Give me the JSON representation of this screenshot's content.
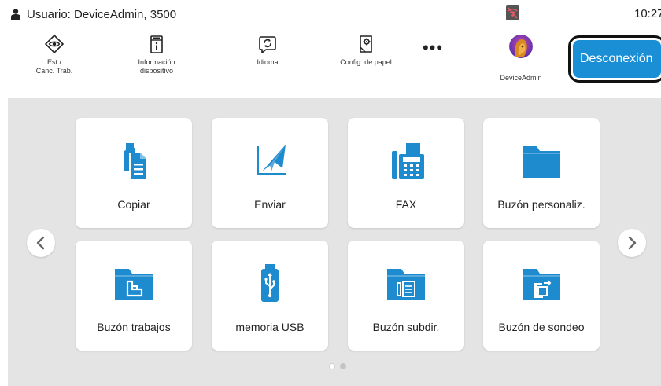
{
  "status_bar": {
    "user_text": "Usuario:  DeviceAdmin, 3500",
    "clock": "10:27",
    "user_icon": "user-icon",
    "network_icon": "wifi-off-icon"
  },
  "toolbar": {
    "items": [
      {
        "label": "Est./\nCanc. Trab.",
        "icon": "eye-diamond-icon"
      },
      {
        "label": "Información\ndispositivo",
        "icon": "device-info-icon"
      },
      {
        "label": "Idioma",
        "icon": "language-refresh-icon"
      },
      {
        "label": "Config. de papel",
        "icon": "paper-settings-icon"
      }
    ],
    "more_label": "•••",
    "user_label": "DeviceAdmin",
    "logout_label": "Desconexión"
  },
  "functions": {
    "page1": [
      {
        "label": "Copiar",
        "icon": "copy-icon"
      },
      {
        "label": "Enviar",
        "icon": "send-icon"
      },
      {
        "label": "FAX",
        "icon": "fax-icon"
      },
      {
        "label": "Buzón personaliz.",
        "icon": "folder-icon"
      },
      {
        "label": "Buzón trabajos",
        "icon": "job-box-icon"
      },
      {
        "label": "memoria USB",
        "icon": "usb-icon"
      },
      {
        "label": "Buzón subdir.",
        "icon": "subaddress-box-icon"
      },
      {
        "label": "Buzón de sondeo",
        "icon": "polling-box-icon"
      }
    ]
  },
  "pagination": {
    "current": 1,
    "total": 2
  },
  "colors": {
    "accent": "#1a8fd6",
    "icon": "#1e8bcf",
    "panel_bg": "#e4e4e4",
    "dot_active": "#bfbfbf",
    "dot_inactive": "#ffffff"
  }
}
